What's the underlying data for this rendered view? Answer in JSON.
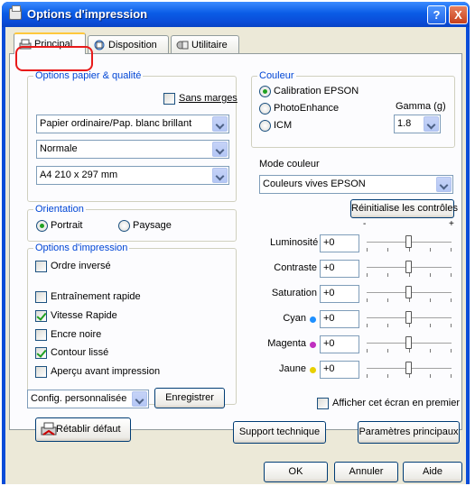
{
  "window": {
    "title": "Options d'impression",
    "help": "?",
    "close": "X"
  },
  "tabs": [
    {
      "label": "Principal"
    },
    {
      "label": "Disposition"
    },
    {
      "label": "Utilitaire"
    }
  ],
  "paper_quality": {
    "title": "Options papier & qualité",
    "sans_marges": "Sans marges",
    "sans_marges_checked": false,
    "paper_type": "Papier ordinaire/Pap. blanc brillant",
    "quality": "Normale",
    "size": "A4 210 x 297 mm"
  },
  "orientation": {
    "title": "Orientation",
    "portrait": "Portrait",
    "paysage": "Paysage",
    "selected": "Portrait"
  },
  "print_options": {
    "title": "Options d'impression",
    "items": [
      {
        "label": "Ordre inversé",
        "checked": false
      },
      {
        "label": "Entraînement rapide",
        "checked": false
      },
      {
        "label": "Vitesse Rapide",
        "checked": true
      },
      {
        "label": "Encre noire",
        "checked": false
      },
      {
        "label": "Contour lissé",
        "checked": true
      },
      {
        "label": "Aperçu avant impression",
        "checked": false
      }
    ]
  },
  "config": {
    "value": "Config. personnalisée",
    "save": "Enregistrer",
    "reset": "Rétablir défaut"
  },
  "color": {
    "title": "Couleur",
    "options": [
      "Calibration EPSON",
      "PhotoEnhance",
      "ICM"
    ],
    "selected": "Calibration EPSON",
    "gamma_label": "Gamma (g)",
    "gamma": "1.8",
    "mode_label": "Mode couleur",
    "mode": "Couleurs vives EPSON",
    "reset_controls": "Réinitialise les contrôles",
    "minus": "-",
    "plus": "+"
  },
  "sliders": [
    {
      "label": "Luminosité",
      "value": "+0",
      "dot": ""
    },
    {
      "label": "Contraste",
      "value": "+0",
      "dot": ""
    },
    {
      "label": "Saturation",
      "value": "+0",
      "dot": ""
    },
    {
      "label": "Cyan",
      "value": "+0",
      "dot": "#1E90FF"
    },
    {
      "label": "Magenta",
      "value": "+0",
      "dot": "#C030C0"
    },
    {
      "label": "Jaune",
      "value": "+0",
      "dot": "#E8D000"
    }
  ],
  "show_screen": {
    "label": "Afficher cet écran en premier",
    "checked": false
  },
  "support": "Support technique",
  "main_settings": "Paramètres principaux",
  "footer": {
    "ok": "OK",
    "cancel": "Annuler",
    "help": "Aide"
  }
}
